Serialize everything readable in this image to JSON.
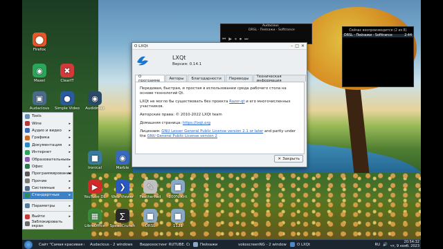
{
  "desktop": {
    "icons": [
      {
        "label": "Firefox",
        "symbol": "⬤",
        "color": "#e8562a"
      },
      {
        "label": "Maxel",
        "symbol": "◉",
        "color": "#2aa55a"
      },
      {
        "label": "ClearIT",
        "symbol": "✖",
        "color": "#d23a3a"
      },
      {
        "label": "Audacious",
        "symbol": "▣",
        "color": "#4a6a8a"
      },
      {
        "label": "Simple Video",
        "symbol": "●",
        "color": "#2a5aa0"
      },
      {
        "label": "Audidmax",
        "symbol": "◉",
        "color": "#2a4a6a"
      },
      {
        "label": "Ironical",
        "symbol": "■",
        "color": "#3a7aa0"
      },
      {
        "label": "Marble",
        "symbol": "◉",
        "color": "#3a6ac0"
      },
      {
        "label": "YouTube DL",
        "symbol": "▶",
        "color": "#d22a2a"
      },
      {
        "label": "Web Viewer",
        "symbol": "❯",
        "color": "#2a5ac0"
      },
      {
        "label": "FeatherPad",
        "symbol": "✎",
        "color": "#c0c0c0"
      },
      {
        "label": "100% Krit",
        "symbol": "■",
        "color": "#8aa8c8"
      },
      {
        "label": "LibreOffice",
        "symbol": "▦",
        "color": "#3a8a3a"
      },
      {
        "label": "SpeedCrunch",
        "symbol": "∑",
        "color": "#2a2a2a"
      },
      {
        "label": "DRSL",
        "symbol": "■",
        "color": "#8aa8c8"
      },
      {
        "label": "1121",
        "symbol": "■",
        "color": "#8aa8c8"
      }
    ]
  },
  "start_menu": {
    "items": [
      {
        "label": "Tools",
        "color": "#6a8fb5",
        "has_sub": false,
        "active": false
      },
      {
        "label": "Wine",
        "color": "#b53a3a",
        "has_sub": true,
        "active": false
      },
      {
        "label": "Аудио и видео",
        "color": "#3a6ab5",
        "has_sub": true,
        "active": false
      },
      {
        "label": "Графика",
        "color": "#c56a2a",
        "has_sub": true,
        "active": false
      },
      {
        "label": "Документация",
        "color": "#2a8ac5",
        "has_sub": true,
        "active": false
      },
      {
        "label": "Интернет",
        "color": "#2aa55a",
        "has_sub": true,
        "active": false
      },
      {
        "label": "Образовательные",
        "color": "#8a5ab5",
        "has_sub": true,
        "active": false
      },
      {
        "label": "Офис",
        "color": "#2a7a4a",
        "has_sub": true,
        "active": false
      },
      {
        "label": "Программирование",
        "color": "#5a5a5a",
        "has_sub": true,
        "active": false
      },
      {
        "label": "Прочие",
        "color": "#7a7a7a",
        "has_sub": true,
        "active": false
      },
      {
        "label": "Системные",
        "color": "#4a6a8a",
        "has_sub": true,
        "active": false
      },
      {
        "label": "Стандартные",
        "color": "#2a8a5a",
        "has_sub": true,
        "active": true
      }
    ],
    "bottom_items": [
      {
        "label": "Параметры",
        "color": "#5a7a9a",
        "has_sub": true
      },
      {
        "label": "Выйти",
        "color": "#c53a3a",
        "has_sub": true
      },
      {
        "label": "Заблокировать экран",
        "color": "#6a6a6a",
        "has_sub": false
      }
    ]
  },
  "dialog": {
    "window_title": "О LXQt",
    "app_name": "LXQt",
    "version": "Версия: 0.14.1",
    "tabs": [
      "О программе",
      "Авторы",
      "Благодарности",
      "Переводы",
      "Техническая информация"
    ],
    "active_tab": 0,
    "paragraph1": "Передовая, быстрая, и простая в использовании среда рабочего стола на основе технологий Qt.",
    "paragraph2_pre": "LXQt не могло бы существовать без проекта ",
    "paragraph2_link": "Razor-qt",
    "paragraph2_post": " и его многочисленных участников.",
    "copyright": "Авторские права: © 2010-2022 LXQt team",
    "homepage_label": "Домашняя страница: ",
    "homepage_link": "https://lxqt.org",
    "license_pre": "Лицензия: ",
    "license_link1": "GNU Lesser General Public License version 2.1 or later",
    "license_mid": " and partly under the ",
    "license_link2": "GNU General Public License version 2",
    "close_label": "Закрыть"
  },
  "audacious": {
    "title": "Audacious",
    "track": "DRSL - Пейзажи - Softtrance"
  },
  "playlist": {
    "title": "Сейчас воспроизводится (2 из 8)",
    "row_track": "DRSL - Пейзажи - Softtrance",
    "row_time": "2:44"
  },
  "taskbar": {
    "tasks": [
      {
        "label": "Сайт \"Самая красивая му...",
        "color": "#e8562a"
      },
      {
        "label": "Audacious - 2 windows",
        "color": "#4a6a8a"
      },
      {
        "label": "Видеохостинг RUTUBE. Смо...",
        "color": "#2a5aa0"
      },
      {
        "label": "Пейзажи",
        "color": "#8aa8c8"
      },
      {
        "label": "vokoscreenNG - 2 windows",
        "color": "#c53a3a"
      },
      {
        "label": "О LXQt",
        "color": "#4a8ac5"
      }
    ],
    "lang": "RU",
    "time": "20:54:32",
    "date": "чт, 9 нояб. 2023"
  }
}
